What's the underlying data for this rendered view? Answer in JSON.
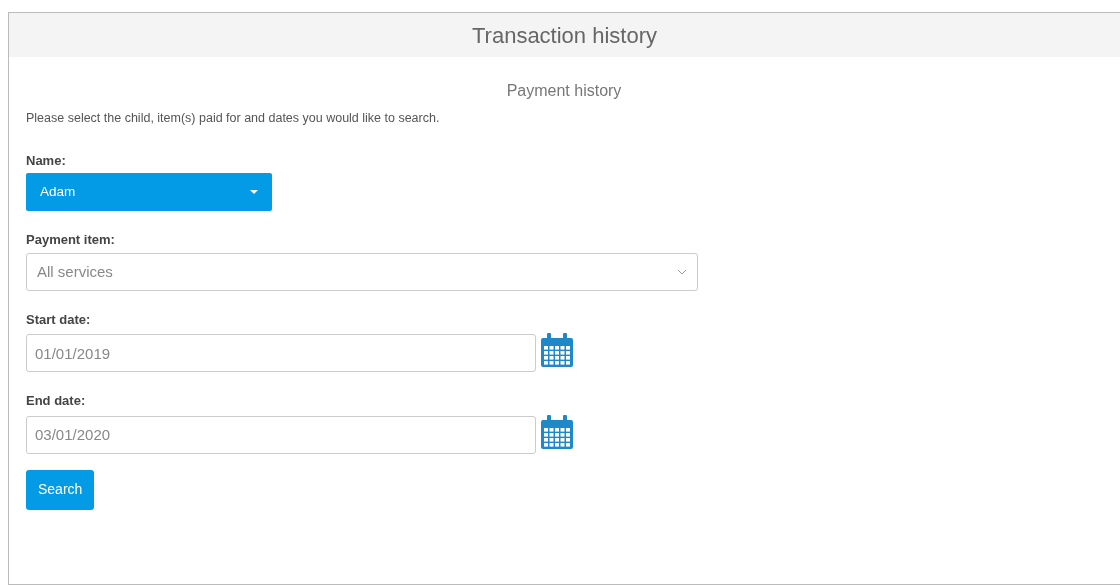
{
  "panel": {
    "title": "Transaction history"
  },
  "section": {
    "title": "Payment history",
    "instructions": "Please select the child, item(s) paid for and dates you would like to search."
  },
  "fields": [
    {
      "kind": "dropdown-button",
      "label": "Name:",
      "value": "Adam"
    },
    {
      "kind": "select",
      "label": "Payment item:",
      "value": "All services"
    },
    {
      "kind": "date",
      "label": "Start date:",
      "value": "01/01/2019"
    },
    {
      "kind": "date",
      "label": "End date:",
      "value": "03/01/2020"
    }
  ],
  "buttons": [
    "Search"
  ]
}
